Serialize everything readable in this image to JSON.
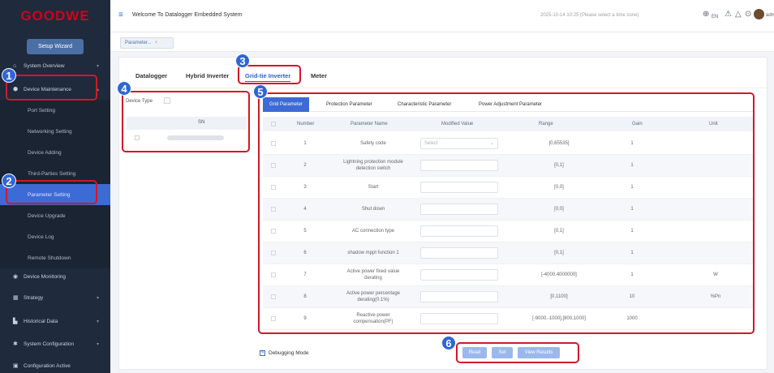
{
  "brand": {
    "logo_text": "GOODWE",
    "logo_color": "#d0021b"
  },
  "sidebar": {
    "wizard_label": "Setup Wizard",
    "items": [
      {
        "label": "System Overview",
        "icon": "home-icon"
      },
      {
        "label": "Device Maintenance",
        "icon": "shield-icon"
      }
    ],
    "sub_items": [
      {
        "label": "Port Setting"
      },
      {
        "label": "Networking Setting"
      },
      {
        "label": "Device Adding"
      },
      {
        "label": "Third-Parties Setting"
      },
      {
        "label": "Parameter Setting"
      },
      {
        "label": "Device Upgrade"
      },
      {
        "label": "Device Log"
      },
      {
        "label": "Remote Shutdown"
      }
    ],
    "bottom_items": [
      {
        "label": "Device Monitoring",
        "icon": "monitor-icon"
      },
      {
        "label": "Strategy",
        "icon": "strategy-icon"
      },
      {
        "label": "Historical Data",
        "icon": "chart-icon"
      },
      {
        "label": "System Configuration",
        "icon": "gear-icon"
      },
      {
        "label": "Configuration Active",
        "icon": "config-icon"
      }
    ]
  },
  "topbar": {
    "title": "Welcome To Datalogger Embedded System",
    "time": "2025-10-14 10:25 (Please select a time zone)",
    "lang": "EN",
    "user": "admin"
  },
  "page_tab": {
    "label": "Parameter..."
  },
  "main_tabs": [
    "Datalogger",
    "Hybrid Inverter",
    "Grid-tie Inverter",
    "Meter"
  ],
  "device_panel": {
    "label": "Device Type",
    "sn_header": "SN"
  },
  "param_tabs": [
    "Grid Parameter",
    "Protection Parameter",
    "Characteristic Parameter",
    "Power Adjustment Parameter"
  ],
  "table": {
    "headers": [
      "Number",
      "Parameter Name",
      "Modified Value",
      "Range",
      "Gain",
      "Unit"
    ],
    "rows": [
      {
        "number": "1",
        "name": "Safety code",
        "modified": "Select",
        "range": "[0,65535]",
        "gain": "1",
        "unit": ""
      },
      {
        "number": "2",
        "name": "Lightning protection module detection switch",
        "modified": "",
        "range": "[0,1]",
        "gain": "1",
        "unit": ""
      },
      {
        "number": "3",
        "name": "Start",
        "modified": "",
        "range": "[0,0]",
        "gain": "1",
        "unit": ""
      },
      {
        "number": "4",
        "name": "Shut down",
        "modified": "",
        "range": "[0,0]",
        "gain": "1",
        "unit": ""
      },
      {
        "number": "5",
        "name": "AC connection type",
        "modified": "",
        "range": "[0,1]",
        "gain": "1",
        "unit": ""
      },
      {
        "number": "6",
        "name": "shadow mppt function 1",
        "modified": "",
        "range": "[0,1]",
        "gain": "1",
        "unit": ""
      },
      {
        "number": "7",
        "name": "Active power fixed value derating",
        "modified": "",
        "range": "[-4000,4000000]",
        "gain": "1",
        "unit": "W"
      },
      {
        "number": "8",
        "name": "Active power percentage derating(0.1%)",
        "modified": "",
        "range": "[0,1100]",
        "gain": "10",
        "unit": "%Pn"
      },
      {
        "number": "9",
        "name": "Reactive power compensation(PF)",
        "modified": "",
        "range": "[-9000,-1000],[800,1000]",
        "gain": "1000",
        "unit": ""
      }
    ]
  },
  "footer": {
    "debug_label": "Debugging Mode",
    "buttons": [
      "Read",
      "Set",
      "View Results"
    ]
  },
  "annotations": [
    "1",
    "2",
    "3",
    "4",
    "5",
    "6"
  ]
}
